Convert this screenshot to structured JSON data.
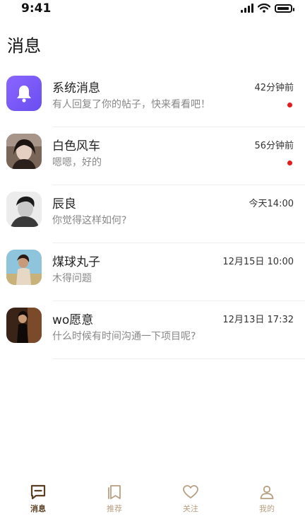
{
  "status_bar": {
    "time": "9:41"
  },
  "page_title": "消息",
  "messages": [
    {
      "name": "系统消息",
      "preview": "有人回复了你的帖子，快来看看吧！",
      "time": "42分钟前",
      "unread": true,
      "avatar": "bell-icon"
    },
    {
      "name": "白色风车",
      "preview": "嗯嗯，好的",
      "time": "56分钟前",
      "unread": true,
      "avatar": "user-photo"
    },
    {
      "name": "辰良",
      "preview": "你觉得这样如何?",
      "time": "今天14:00",
      "unread": false,
      "avatar": "user-photo"
    },
    {
      "name": "煤球丸子",
      "preview": "木得问题",
      "time": "12月15日 10:00",
      "unread": false,
      "avatar": "user-photo"
    },
    {
      "name": "wo愿意",
      "preview": "什么时候有时间沟通一下项目呢?",
      "time": "12月13日 17:32",
      "unread": false,
      "avatar": "user-photo"
    }
  ],
  "tabbar": {
    "items": [
      {
        "label": "消息",
        "icon": "message-icon",
        "active": true
      },
      {
        "label": "推荐",
        "icon": "bookmark-icon",
        "active": false
      },
      {
        "label": "关注",
        "icon": "heart-icon",
        "active": false
      },
      {
        "label": "我的",
        "icon": "profile-icon",
        "active": false
      }
    ]
  },
  "colors": {
    "accent": "#5a3f22",
    "inactive_tab": "#b79f82",
    "unread_dot": "#e31c1c",
    "system_avatar": "#7b5cf6"
  }
}
